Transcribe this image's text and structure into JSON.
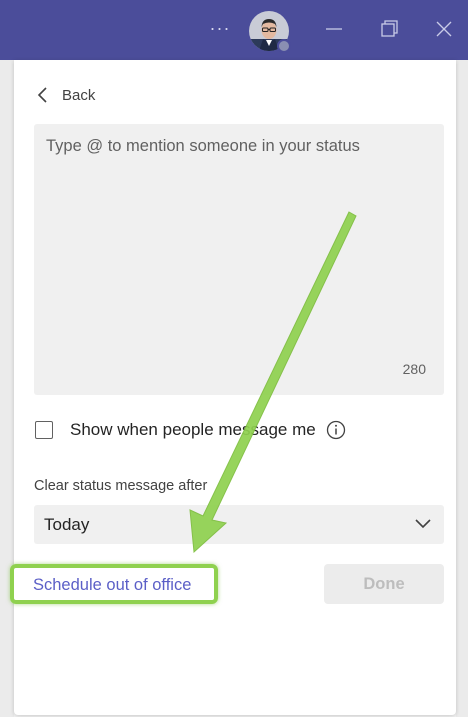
{
  "titlebar": {
    "more_label": "···",
    "icons": {
      "more": "more-icon",
      "minimize": "minimize-icon",
      "restore": "restore-icon",
      "close": "close-icon"
    },
    "colors": {
      "bar": "#4b4d9a"
    }
  },
  "panel": {
    "back_label": "Back",
    "message": {
      "placeholder": "Type @ to mention someone in your status",
      "char_count": "280"
    },
    "show_when_message": {
      "label": "Show when people message me",
      "checked": false
    },
    "clear_after": {
      "label": "Clear status message after",
      "selected": "Today"
    },
    "schedule_link": "Schedule out of office",
    "done_label": "Done"
  },
  "colors": {
    "accent": "#5b5fc7",
    "highlight": "#8fd14f"
  }
}
